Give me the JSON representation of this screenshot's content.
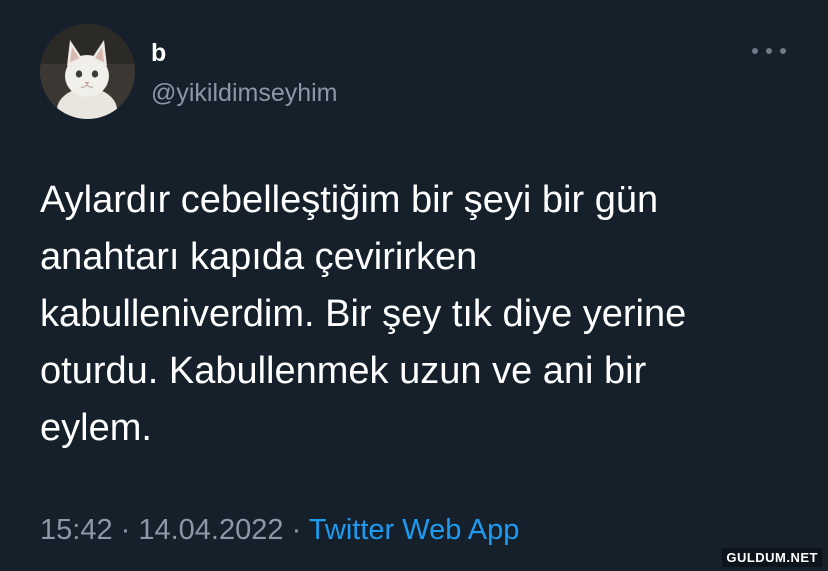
{
  "user": {
    "display_name": "b",
    "handle": "@yikildimseyhim",
    "avatar_icon": "cat-avatar-icon"
  },
  "tweet": {
    "text": "Aylardır cebelleştiğim bir şeyi bir gün\nanahtarı kapıda çevirirken\nkabulleniverdim. Bir şey tık diye yerine\noturdu. Kabullenmek uzun ve ani bir\neylem.",
    "time": "15:42",
    "date": "14.04.2022",
    "separator": " · ",
    "source": "Twitter Web App"
  },
  "more_icon": "more-options-icon",
  "watermark": "GULDUM.NET",
  "colors": {
    "background": "#15202b",
    "text": "#ffffff",
    "secondary": "#8b98a5",
    "accent": "#1d9bf0"
  }
}
